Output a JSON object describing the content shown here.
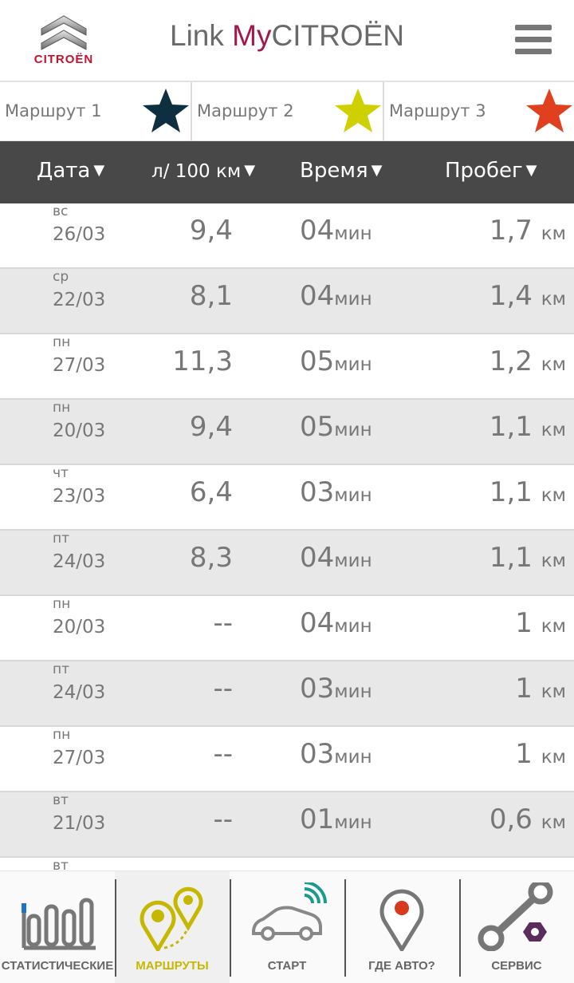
{
  "header": {
    "brand": "CITROËN",
    "title_prefix": "Link ",
    "title_my": "My",
    "title_suffix": "CITROËN",
    "colors": {
      "brand_red": "#c8102e",
      "my_accent": "#a3174b"
    }
  },
  "routes": [
    {
      "label": "Маршрут 1",
      "star_color": "#0e2f3f",
      "icon": "star-icon"
    },
    {
      "label": "Маршрут 2",
      "star_color": "#cfd000",
      "icon": "star-icon"
    },
    {
      "label": "Маршрут 3",
      "star_color": "#e0401e",
      "icon": "star-icon"
    }
  ],
  "columns": {
    "date": "Дата",
    "consumption": "л/ 100 км",
    "time": "Время",
    "distance": "Пробег",
    "sort_arrow": "▼"
  },
  "units": {
    "time": "мин",
    "distance": "км"
  },
  "trips": [
    {
      "day": "вс",
      "date": "26/03",
      "consumption": "9,4",
      "time": "04",
      "distance": "1,7"
    },
    {
      "day": "ср",
      "date": "22/03",
      "consumption": "8,1",
      "time": "04",
      "distance": "1,4"
    },
    {
      "day": "пн",
      "date": "27/03",
      "consumption": "11,3",
      "time": "05",
      "distance": "1,2"
    },
    {
      "day": "пн",
      "date": "20/03",
      "consumption": "9,4",
      "time": "05",
      "distance": "1,1"
    },
    {
      "day": "чт",
      "date": "23/03",
      "consumption": "6,4",
      "time": "03",
      "distance": "1,1"
    },
    {
      "day": "пт",
      "date": "24/03",
      "consumption": "8,3",
      "time": "04",
      "distance": "1,1"
    },
    {
      "day": "пн",
      "date": "20/03",
      "consumption": "--",
      "time": "04",
      "distance": "1"
    },
    {
      "day": "пт",
      "date": "24/03",
      "consumption": "--",
      "time": "03",
      "distance": "1"
    },
    {
      "day": "пн",
      "date": "27/03",
      "consumption": "--",
      "time": "03",
      "distance": "1"
    },
    {
      "day": "вт",
      "date": "21/03",
      "consumption": "--",
      "time": "01",
      "distance": "0,6"
    },
    {
      "day": "вт",
      "date": "",
      "consumption": "",
      "time": "",
      "distance": ""
    }
  ],
  "nav": [
    {
      "label": "СТАТИСТИЧЕСКИЕ",
      "icon": "statistics-icon"
    },
    {
      "label": "МАРШРУТЫ",
      "icon": "routes-icon",
      "active": true,
      "active_color": "#c6b800"
    },
    {
      "label": "СТАРТ",
      "icon": "car-connected-icon"
    },
    {
      "label": "ГДЕ АВТО?",
      "icon": "location-pin-icon"
    },
    {
      "label": "СЕРВИС",
      "icon": "wrench-icon"
    }
  ]
}
